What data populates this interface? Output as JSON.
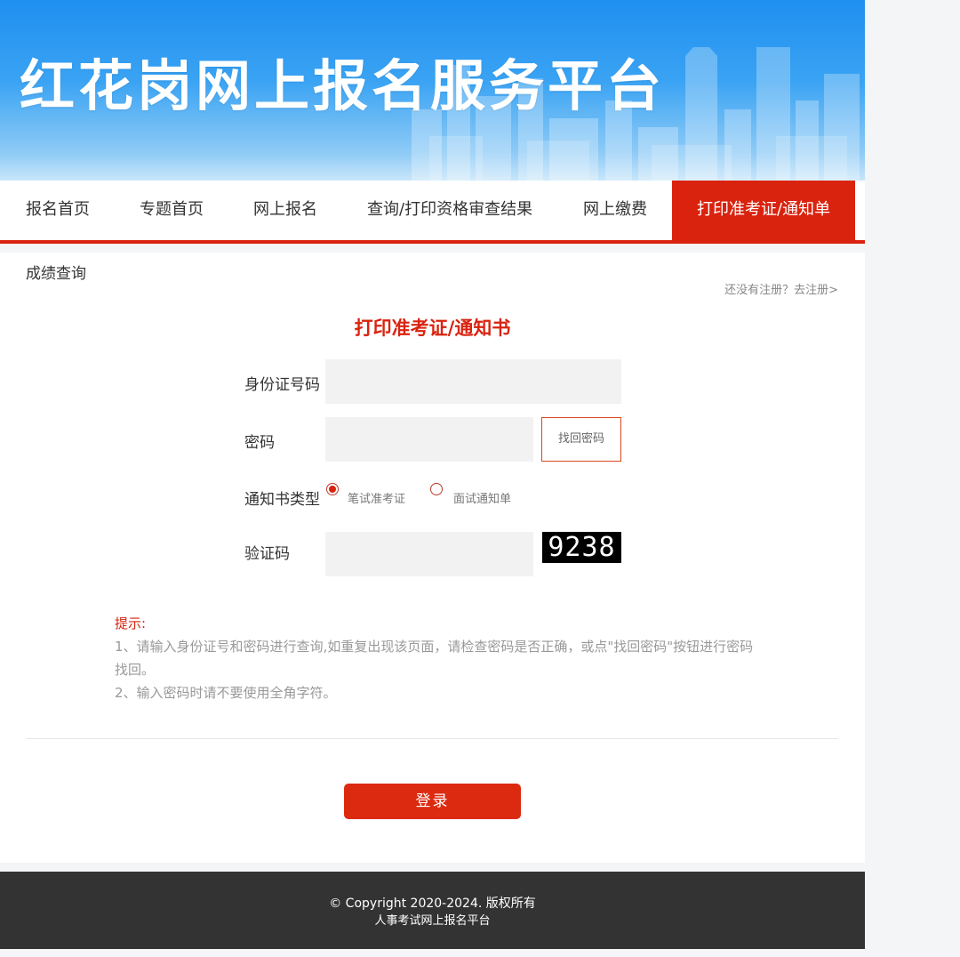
{
  "header": {
    "site_title": "红花岗网上报名服务平台"
  },
  "nav": {
    "items": [
      {
        "label": "报名首页"
      },
      {
        "label": "专题首页"
      },
      {
        "label": "网上报名"
      },
      {
        "label": "查询/打印资格审查结果"
      },
      {
        "label": "网上缴费"
      },
      {
        "label": "打印准考证/通知单",
        "active": true
      }
    ]
  },
  "subnav": {
    "label": "成绩查询"
  },
  "register_link": "还没有注册？去注册>",
  "form": {
    "title": "打印准考证/通知书",
    "id_label": "身份证号码",
    "id_value": "",
    "password_label": "密码",
    "password_value": "",
    "retrieve_button": "找回密码",
    "type_label": "通知书类型",
    "type_options": [
      {
        "label": "笔试准考证",
        "checked": true
      },
      {
        "label": "面试通知单",
        "checked": false
      }
    ],
    "captcha_label": "验证码",
    "captcha_value": "",
    "captcha_code": "9238"
  },
  "tips": {
    "title": "提示:",
    "line1": "1、请输入身份证号和密码进行查询,如重复出现该页面，请检查密码是否正确，或点\"找回密码\"按钮进行密码找回。",
    "line2": "2、输入密码时请不要使用全角字符。"
  },
  "login_button": "登录",
  "footer": {
    "copyright": "© Copyright 2020-2024. 版权所有",
    "platform": "人事考试网上报名平台"
  },
  "colors": {
    "accent": "#d9230f",
    "banner_blue": "#2b96f1",
    "footer_bg": "#333333"
  }
}
